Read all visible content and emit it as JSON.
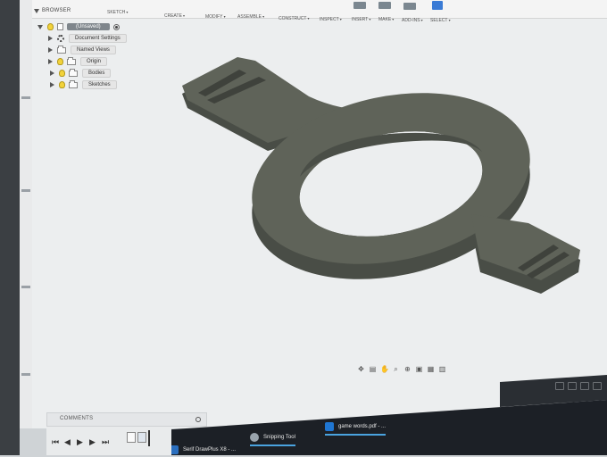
{
  "toolbar": {
    "items": [
      {
        "label": "SKETCH",
        "icon": "sketch-icon",
        "color": "#3a7bd5"
      },
      {
        "label": "CREATE",
        "icon": "create-icon",
        "color": "#5a8ad8"
      },
      {
        "label": "MODIFY",
        "icon": "modify-icon",
        "color": "#7a8a96"
      },
      {
        "label": "ASSEMBLE",
        "icon": "assemble-icon",
        "color": "#8a8a8a"
      },
      {
        "label": "CONSTRUCT",
        "icon": "construct-icon",
        "color": "#d0893a"
      },
      {
        "label": "INSPECT",
        "icon": "inspect-icon",
        "color": "#6f7d88"
      },
      {
        "label": "INSERT",
        "icon": "insert-icon",
        "color": "#7b8790"
      },
      {
        "label": "MAKE",
        "icon": "make-icon",
        "color": "#7b8790"
      },
      {
        "label": "ADD-INS",
        "icon": "add-ins-icon",
        "color": "#7b8790"
      },
      {
        "label": "SELECT",
        "icon": "select-icon",
        "color": "#3a7bd5"
      }
    ]
  },
  "browser": {
    "title": "BROWSER",
    "root": "(Unsaved)",
    "items": [
      {
        "label": "Document Settings",
        "icon": "gear-icon"
      },
      {
        "label": "Named Views",
        "icon": "folder-icon"
      },
      {
        "label": "Origin",
        "icon": "folder-icon"
      },
      {
        "label": "Bodies",
        "icon": "folder-icon"
      },
      {
        "label": "Sketches",
        "icon": "folder-icon"
      }
    ]
  },
  "comments": {
    "title": "COMMENTS"
  },
  "timeline": {
    "controls": [
      "first-icon",
      "previous-icon",
      "play-icon",
      "next-icon",
      "last-icon"
    ]
  },
  "taskbar": {
    "tasks": [
      {
        "label": "Serif DrawPlus X8 - ...",
        "color": "#2b6fbf"
      },
      {
        "label": "Snipping Tool",
        "color": "#9aa4ad"
      },
      {
        "label": "game words.pdf - ...",
        "color": "#1f76d2"
      }
    ]
  },
  "colors": {
    "model": "#5f6359",
    "canvas": "#eceeef"
  }
}
